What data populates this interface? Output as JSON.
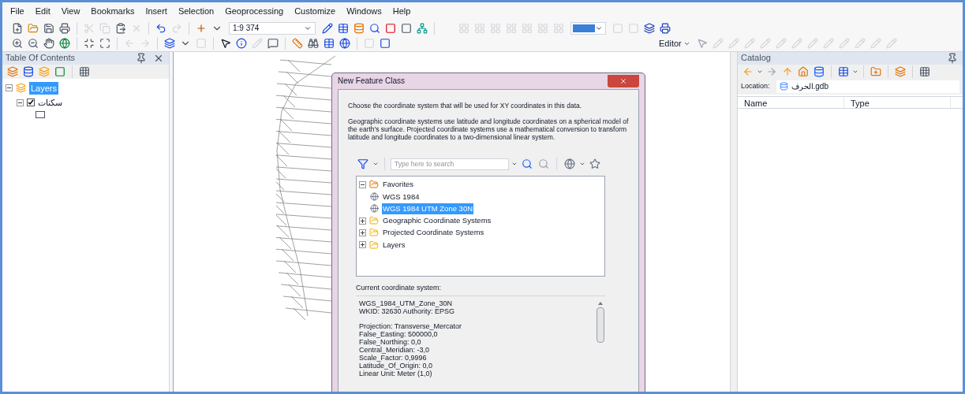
{
  "menu": [
    "File",
    "Edit",
    "View",
    "Bookmarks",
    "Insert",
    "Selection",
    "Geoprocessing",
    "Customize",
    "Windows",
    "Help"
  ],
  "toolbar": {
    "scale": "1:9 374",
    "editor": "Editor"
  },
  "toc": {
    "title": "Table Of Contents",
    "tree": [
      {
        "label": "Layers",
        "selected": true,
        "expanded": true,
        "children": [
          {
            "label": "سكنات",
            "selected": false,
            "checked": true,
            "expanded": true
          }
        ]
      }
    ]
  },
  "dialog": {
    "title": "New Feature Class",
    "intro": "Choose the coordinate system that will be used for XY coordinates in this data.",
    "description": "Geographic coordinate systems use latitude and longitude coordinates on a spherical model of the earth's surface. Projected coordinate systems use a mathematical conversion to transform latitude and longitude coordinates to a two-dimensional linear system.",
    "search": {
      "placeholder": "Type here to search"
    },
    "tree": [
      {
        "label": "Favorites",
        "kind": "favorites",
        "selected": false,
        "expanded": true,
        "children": [
          {
            "label": "WGS 1984",
            "kind": "crs",
            "selected": false
          },
          {
            "label": "WGS 1984 UTM Zone 30N",
            "kind": "crs",
            "selected": true
          }
        ]
      },
      {
        "label": "Geographic Coordinate Systems",
        "kind": "folder",
        "selected": false,
        "expanded": false
      },
      {
        "label": "Projected Coordinate Systems",
        "kind": "folder",
        "selected": false,
        "expanded": false
      },
      {
        "label": "Layers",
        "kind": "folder",
        "selected": false,
        "expanded": false
      }
    ],
    "current_label": "Current coordinate system:",
    "current_blocks": [
      [
        "WGS_1984_UTM_Zone_30N",
        "WKID: 32630 Authority: EPSG"
      ],
      [
        "Projection: Transverse_Mercator",
        "False_Easting: 500000,0",
        "False_Northing: 0,0",
        "Central_Meridian: -3,0",
        "Scale_Factor: 0,9996",
        "Latitude_Of_Origin: 0,0",
        "Linear Unit: Meter (1,0)"
      ]
    ]
  },
  "catalog": {
    "title": "Catalog",
    "location_label": "Location:",
    "location": "الحرف.gdb",
    "columns": [
      "Name",
      "Type"
    ]
  }
}
